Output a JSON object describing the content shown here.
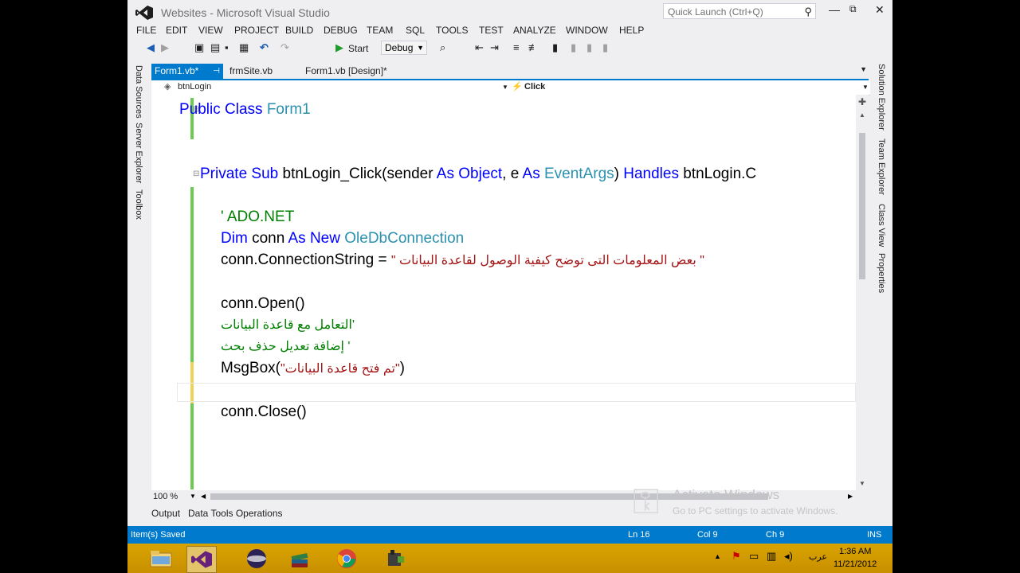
{
  "window": {
    "title": "Websites - Microsoft Visual Studio"
  },
  "quick_launch": {
    "placeholder": "Quick Launch (Ctrl+Q)"
  },
  "menu": [
    "FILE",
    "EDIT",
    "VIEW",
    "PROJECT",
    "BUILD",
    "DEBUG",
    "TEAM",
    "SQL",
    "TOOLS",
    "TEST",
    "ANALYZE",
    "WINDOW",
    "HELP"
  ],
  "toolbar": {
    "start_label": "Start",
    "config": "Debug"
  },
  "left_panels": [
    "Data Sources",
    "Server Explorer",
    "Toolbox"
  ],
  "right_panels": [
    "Solution Explorer",
    "Team Explorer",
    "Class View",
    "Properties"
  ],
  "tabs": [
    {
      "label": "Form1.vb*",
      "active": true
    },
    {
      "label": "frmSite.vb",
      "active": false
    },
    {
      "label": "Form1.vb [Design]*",
      "active": false
    }
  ],
  "nav": {
    "object": "btnLogin",
    "member": "Click"
  },
  "code": {
    "l1_kw": "Public Class ",
    "l1_type": "Form1",
    "l2_kw1": "Private Sub ",
    "l2_t1": "btnLogin_Click(sender ",
    "l2_kw2": "As ",
    "l2_kw3": "Object",
    "l2_t2": ", e ",
    "l2_kw4": "As ",
    "l2_type": "EventArgs",
    "l2_t3": ") ",
    "l2_kw5": "Handles ",
    "l2_t4": "btnLogin.C",
    "l3_comment": "' ADO.NET",
    "l4_kw1": "Dim ",
    "l4_t1": "conn ",
    "l4_kw2": "As New ",
    "l4_type": "OleDbConnection",
    "l5_t1": "conn.ConnectionString = ",
    "l5_str": "\" بعض المعلومات التى توضح كيفية الوصول لقاعدة البيانات \"",
    "l6": "conn.Open()",
    "l7_comment": "'التعامل مع قاعدة البيانات",
    "l8_comment": "' إضافة تعديل حذف بحث",
    "l9_t1": "MsgBox(",
    "l9_str": "\"تم فتح قاعدة البيانات\"",
    "l9_t2": ")",
    "l10": "conn.Close()"
  },
  "zoom": "100 %",
  "output_tabs": [
    "Output",
    "Data Tools Operations"
  ],
  "watermark": {
    "line1": "Activate Windows",
    "line2": "Go to PC settings to activate Windows."
  },
  "status": {
    "message": "Item(s) Saved",
    "ln": "Ln 16",
    "col": "Col 9",
    "ch": "Ch 9",
    "mode": "INS"
  },
  "tray": {
    "lang": "عرب",
    "time": "1:36 AM",
    "date": "11/21/2012"
  },
  "colors": {
    "accent": "#007acc",
    "keyword": "#0000ff",
    "type": "#2b91af",
    "comment": "#008000",
    "string": "#a31515",
    "taskbar": "#d4a000"
  }
}
